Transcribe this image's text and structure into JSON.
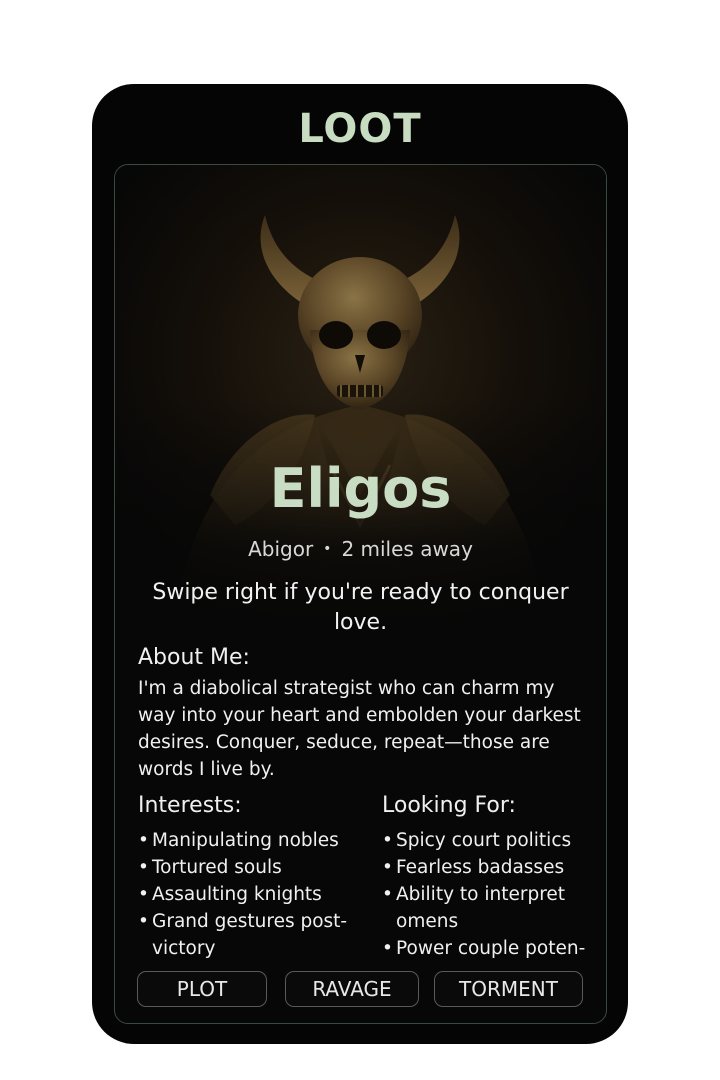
{
  "app": {
    "title": "LOOT"
  },
  "profile": {
    "name": "Eligos",
    "alias": "Abigor",
    "distance": "2 miles away",
    "tagline": "Swipe right if you're ready to conquer love.",
    "about_heading": "About Me:",
    "about_text": "I'm a diabolical strategist who can charm my way into your heart and embolden your darkest desires. Conquer, seduce, repeat—those are words I live by.",
    "interests_heading": "Interests:",
    "interests": [
      "Manipulating nobles",
      "Tortured souls",
      "Assaulting knights",
      "Grand gestures post-victory"
    ],
    "looking_for_heading": "Looking For:",
    "looking_for": [
      "Spicy court politics",
      "Fearless badasses",
      "Ability to interpret omens",
      "Power couple poten-"
    ]
  },
  "actions": {
    "plot_label": "PLOT",
    "ravage_label": "RAVAGE",
    "torment_label": "TORMENT"
  },
  "colors": {
    "accent": "#c7dcc0",
    "background": "#050505",
    "text": "#f0f0f0"
  }
}
